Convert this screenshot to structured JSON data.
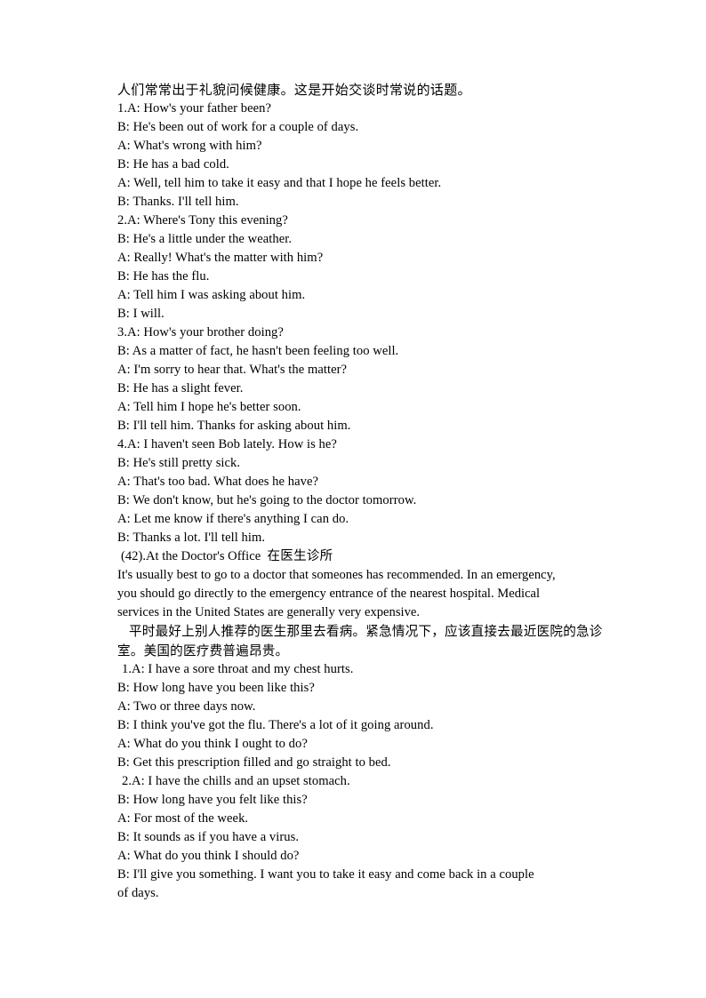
{
  "document": {
    "intro_cn": "人们常常出于礼貌问候健康。这是开始交谈时常说的话题。",
    "dialogues_part1": [
      "1.A: How's your father been?",
      "B: He's been out of work for a couple of days.",
      "A: What's wrong with him?",
      "B: He has a bad cold.",
      "A: Well, tell him to take it easy and that I hope he feels better.",
      "B: Thanks. I'll tell him.",
      "2.A: Where's Tony this evening?",
      "B: He's a little under the weather.",
      "A: Really! What's the matter with him?",
      "B: He has the flu.",
      "A: Tell him I was asking about him.",
      "B: I will.",
      "3.A: How's your brother doing?",
      "B: As a matter of fact, he hasn't been feeling too well.",
      "A: I'm sorry to hear that. What's the matter?",
      "B: He has a slight fever.",
      "A: Tell him I hope he's better soon.",
      "B: I'll tell him. Thanks for asking about him.",
      "4.A: I haven't seen Bob lately. How is he?",
      "B: He's still pretty sick.",
      "A: That's too bad. What does he have?",
      "B: We don't know, but he's going to the doctor tomorrow.",
      "A: Let me know if there's anything I can do.",
      "B: Thanks a lot. I'll tell him."
    ],
    "section": {
      "number_title": "(42).At the Doctor's Office",
      "title_cn": "在医生诊所",
      "paragraph_en": "It's usually best to go to a doctor that someones has recommended. In an emergency, you should go directly to the emergency entrance of the nearest hospital. Medical services in the United States are generally very expensive.",
      "paragraph_cn": "平时最好上别人推荐的医生那里去看病。紧急情况下，应该直接去最近医院的急诊室。美国的医疗费普遍昂贵。"
    },
    "dialogues_part2": [
      "1.A: I have a sore throat and my chest hurts.",
      "B: How long have you been like this?",
      "A: Two or three days now.",
      "B: I think you've got the flu. There's a lot of it going around.",
      "A: What do you think I ought to do?",
      "B: Get this prescription filled and go straight to bed.",
      "2.A: I have the chills and an upset stomach.",
      "B: How long have you felt like this?",
      "A: For most of the week.",
      "B: It sounds as if you have a virus.",
      "A: What do you think I should do?",
      "B: I'll give you something. I want you to take it easy and come back in a couple of days."
    ]
  }
}
